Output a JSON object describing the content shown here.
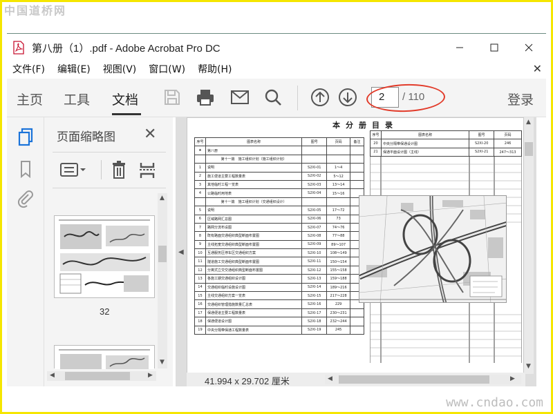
{
  "watermarks": {
    "top": "中国道桥网",
    "bottom": "www.cndao.com"
  },
  "window": {
    "title": "第八册（1）.pdf - Adobe Acrobat Pro DC"
  },
  "menu": [
    "文件(F)",
    "编辑(E)",
    "视图(V)",
    "窗口(W)",
    "帮助(H)"
  ],
  "toolbar": {
    "tabs": [
      "主页",
      "工具",
      "文档"
    ],
    "active_tab": "文档",
    "page_current": "2",
    "page_total": "/ 110",
    "login": "登录"
  },
  "thumbnails_panel": {
    "title": "页面缩略图",
    "thumb_label": "32"
  },
  "document": {
    "page_title": "本分册目录",
    "left_table": {
      "headers": [
        "序号",
        "图表名称",
        "图号",
        "页码",
        "备注"
      ],
      "rows": [
        [
          "★",
          "第八册",
          "",
          "",
          ""
        ],
        [
          "",
          "第十一篇　施工组织计划（施工组织计划）",
          "",
          "",
          ""
        ],
        [
          "1",
          "说明",
          "S2XI-01",
          "1～4",
          ""
        ],
        [
          "2",
          "施工便道主要工程数量表",
          "S2XI-02",
          "5～12",
          ""
        ],
        [
          "3",
          "其他临时工程一览表",
          "S2XI-03",
          "13～14",
          ""
        ],
        [
          "4",
          "公路临时用地表",
          "S2XI-04",
          "15～16",
          ""
        ],
        [
          "",
          "第十一篇　施工组织计划（交通组织设计）",
          "",
          "",
          ""
        ],
        [
          "5",
          "说明",
          "S2XI-05",
          "17～72",
          ""
        ],
        [
          "6",
          "区域路网汇总图",
          "S2XI-06",
          "73",
          ""
        ],
        [
          "7",
          "路网分流布设图",
          "S2XI-07",
          "74～76",
          ""
        ],
        [
          "8",
          "既有路面交通组织典型断面布置图",
          "S2XI-08",
          "77～88",
          ""
        ],
        [
          "9",
          "主线拓宽交通组织典型断面布置图",
          "S2XI-09",
          "89～107",
          ""
        ],
        [
          "10",
          "互通服务区停车区交通组织方案",
          "S2XI-10",
          "108～149",
          ""
        ],
        [
          "11",
          "隧道施工交通组织典型断面布置图",
          "S2XI-11",
          "150～154",
          ""
        ],
        [
          "12",
          "分离式立交交通组织典型断面布置图",
          "S2XI-12",
          "155～158",
          ""
        ],
        [
          "13",
          "各施工期交通组织设计图",
          "S2XI-13",
          "159～188",
          ""
        ],
        [
          "14",
          "交通组织临时设施设计图",
          "S2XI-14",
          "189～216",
          ""
        ],
        [
          "15",
          "主线交通组织方案一览表",
          "S2XI-15",
          "217～228",
          ""
        ],
        [
          "16",
          "交通组织管理措施数量汇总表",
          "S2XI-16",
          "229",
          ""
        ],
        [
          "17",
          "保通便道主要工程数量表",
          "S2XI-17",
          "230～231",
          ""
        ],
        [
          "18",
          "保通便道设计图",
          "S2XI-18",
          "232～244",
          ""
        ],
        [
          "19",
          "中央分隔带保通工程数量表",
          "S2XI-19",
          "245",
          ""
        ]
      ]
    },
    "right_table": {
      "headers": [
        "序号",
        "图表名称",
        "图号",
        "页码"
      ],
      "rows": [
        [
          "20",
          "中央分隔带保通设计图",
          "S2XI-20",
          "246"
        ],
        [
          "21",
          "保通平面设计图（主线）",
          "S2XI-21",
          "247～313"
        ]
      ]
    }
  },
  "status": {
    "dimensions": "41.994 x 29.702 厘米"
  }
}
